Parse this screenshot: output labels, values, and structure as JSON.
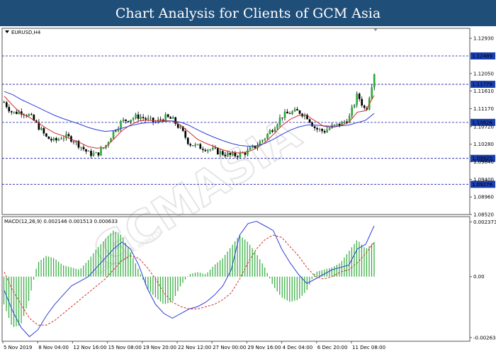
{
  "header": {
    "title": "Chart Analysis for Clients of GCM Asia"
  },
  "watermark": {
    "brand": "GCMASIA",
    "tagline": "GLOBAL CAPITAL MARKETS"
  },
  "chart_data": [
    {
      "type": "candlestick",
      "label": "EURUSD,H4",
      "ylim": [
        1.0852,
        1.1318
      ],
      "y_ticks": [
        1.1293,
        1.1205,
        1.1161,
        1.1117,
        1.1072,
        1.1028,
        1.0984,
        1.094,
        1.0896,
        1.0852
      ],
      "y_tick_labels": [
        "1.12930",
        "1.12050",
        "1.11610",
        "1.11170",
        "1.10720",
        "1.10280",
        "1.09840",
        "1.09400",
        "1.08960",
        "1.08520"
      ],
      "levels": [
        {
          "value": 1.12489,
          "label": "1.12489"
        },
        {
          "value": 1.11779,
          "label": "1.11779"
        },
        {
          "value": 1.10826,
          "label": "1.10826"
        },
        {
          "value": 1.09925,
          "label": "1.09925"
        },
        {
          "value": 1.09276,
          "label": "1.09276"
        }
      ],
      "x_tick_labels": [
        "5 Nov 2019",
        "8 Nov 04:00",
        "12 Nov 16:00",
        "15 Nov 08:00",
        "19 Nov 20:00",
        "22 Nov 12:00",
        "27 Nov 00:00",
        "29 Nov 16:00",
        "4 Dec 04:00",
        "6 Dec 20:00",
        "11 Dec 08:00"
      ],
      "close_path": [
        1.1133,
        1.1106,
        1.111,
        1.11,
        1.1075,
        1.1045,
        1.1035,
        1.1048,
        1.1042,
        1.1025,
        1.1005,
        1.1002,
        1.1022,
        1.106,
        1.1085,
        1.1092,
        1.1098,
        1.109,
        1.1082,
        1.1096,
        1.109,
        1.1065,
        1.103,
        1.1022,
        1.1018,
        1.1012,
        1.1005,
        1.0999,
        1.1002,
        1.101,
        1.1025,
        1.1045,
        1.107,
        1.1098,
        1.1107,
        1.111,
        1.1098,
        1.1067,
        1.106,
        1.1072,
        1.1078,
        1.1093,
        1.1152,
        1.111,
        1.1207
      ],
      "series": [
        {
          "name": "",
          "color": "#d0312d",
          "values": [
            1.1148,
            1.1125,
            1.1105,
            1.1095,
            1.1082,
            1.1068,
            1.1056,
            1.1049,
            1.104,
            1.1032,
            1.1022,
            1.1018,
            1.102,
            1.104,
            1.1062,
            1.1076,
            1.1086,
            1.1088,
            1.1086,
            1.1087,
            1.1086,
            1.1075,
            1.1058,
            1.104,
            1.103,
            1.1022,
            1.1014,
            1.1008,
            1.1006,
            1.1009,
            1.1018,
            1.1032,
            1.1052,
            1.1074,
            1.109,
            1.11,
            1.11,
            1.1086,
            1.1073,
            1.107,
            1.1074,
            1.1083,
            1.1108,
            1.1112,
            1.115
          ]
        },
        {
          "name": "",
          "color": "#2f3fd6",
          "values": [
            1.116,
            1.1152,
            1.114,
            1.113,
            1.112,
            1.111,
            1.11,
            1.1092,
            1.1085,
            1.1078,
            1.107,
            1.1064,
            1.106,
            1.1062,
            1.1068,
            1.1074,
            1.1079,
            1.1082,
            1.1083,
            1.1085,
            1.1086,
            1.1083,
            1.1075,
            1.1064,
            1.1054,
            1.1045,
            1.1037,
            1.103,
            1.1025,
            1.1023,
            1.1024,
            1.103,
            1.104,
            1.1052,
            1.1063,
            1.1071,
            1.1076,
            1.1076,
            1.1074,
            1.1073,
            1.1074,
            1.1076,
            1.1082,
            1.1088,
            1.1105
          ]
        }
      ]
    },
    {
      "type": "macd",
      "label": "MACD(12,26,9) 0.002146 0.001513 0.000633",
      "ylim": [
        -0.0028,
        0.0026
      ],
      "y_ticks": [
        0.002373,
        0.0,
        -0.002639
      ],
      "y_tick_labels": [
        "0.002373",
        "0.00",
        "-0.002639"
      ],
      "histogram": [
        -0.0012,
        -0.0022,
        -0.0021,
        -0.001,
        0.0006,
        0.0009,
        0.0008,
        0.0005,
        0.0004,
        0.0003,
        0.0007,
        0.0012,
        0.0016,
        0.002,
        0.0018,
        0.0011,
        0.0003,
        -0.0005,
        -0.0009,
        -0.0012,
        -0.0011,
        -0.0004,
        0.0001,
        0.0002,
        0.0001,
        0.0005,
        0.0008,
        0.0013,
        0.0018,
        0.0015,
        0.001,
        0.0004,
        -0.0004,
        -0.0009,
        -0.0011,
        -0.001,
        -0.0006,
        0.0002,
        0.0003,
        0.0004,
        0.0006,
        0.0011,
        0.0016,
        0.0012,
        0.0015
      ],
      "series": [
        {
          "name": "",
          "color": "#2f3fd6",
          "values": [
            -0.0006,
            -0.0015,
            -0.0022,
            -0.0026,
            -0.0023,
            -0.0017,
            -0.0012,
            -0.0008,
            -0.0004,
            -0.0002,
            0.0,
            0.0004,
            0.0008,
            0.0012,
            0.0015,
            0.0012,
            0.0005,
            -0.0005,
            -0.0012,
            -0.0016,
            -0.0018,
            -0.0016,
            -0.0014,
            -0.0013,
            -0.0011,
            -0.0008,
            -0.0004,
            0.0003,
            0.0018,
            0.0023,
            0.0024,
            0.0022,
            0.002,
            0.0012,
            0.0006,
            0.0001,
            -0.0003,
            -0.0001,
            0.0001,
            0.0003,
            0.0004,
            0.0005,
            0.0012,
            0.0014,
            0.0022
          ]
        },
        {
          "name": "",
          "color": "#d0312d",
          "values": [
            0.0002,
            -0.0006,
            -0.0012,
            -0.0018,
            -0.0021,
            -0.0021,
            -0.0019,
            -0.0016,
            -0.0013,
            -0.001,
            -0.0007,
            -0.0004,
            -0.0001,
            0.0003,
            0.0007,
            0.0009,
            0.0008,
            0.0004,
            -0.0001,
            -0.0007,
            -0.0011,
            -0.0013,
            -0.0014,
            -0.0014,
            -0.0013,
            -0.0012,
            -0.001,
            -0.0007,
            -0.0001,
            0.0006,
            0.0012,
            0.0016,
            0.0018,
            0.0017,
            0.0013,
            0.0009,
            0.0004,
            0.0,
            -0.0001,
            0.0,
            0.0002,
            0.0003,
            0.0006,
            0.001,
            0.0015
          ]
        }
      ]
    }
  ]
}
